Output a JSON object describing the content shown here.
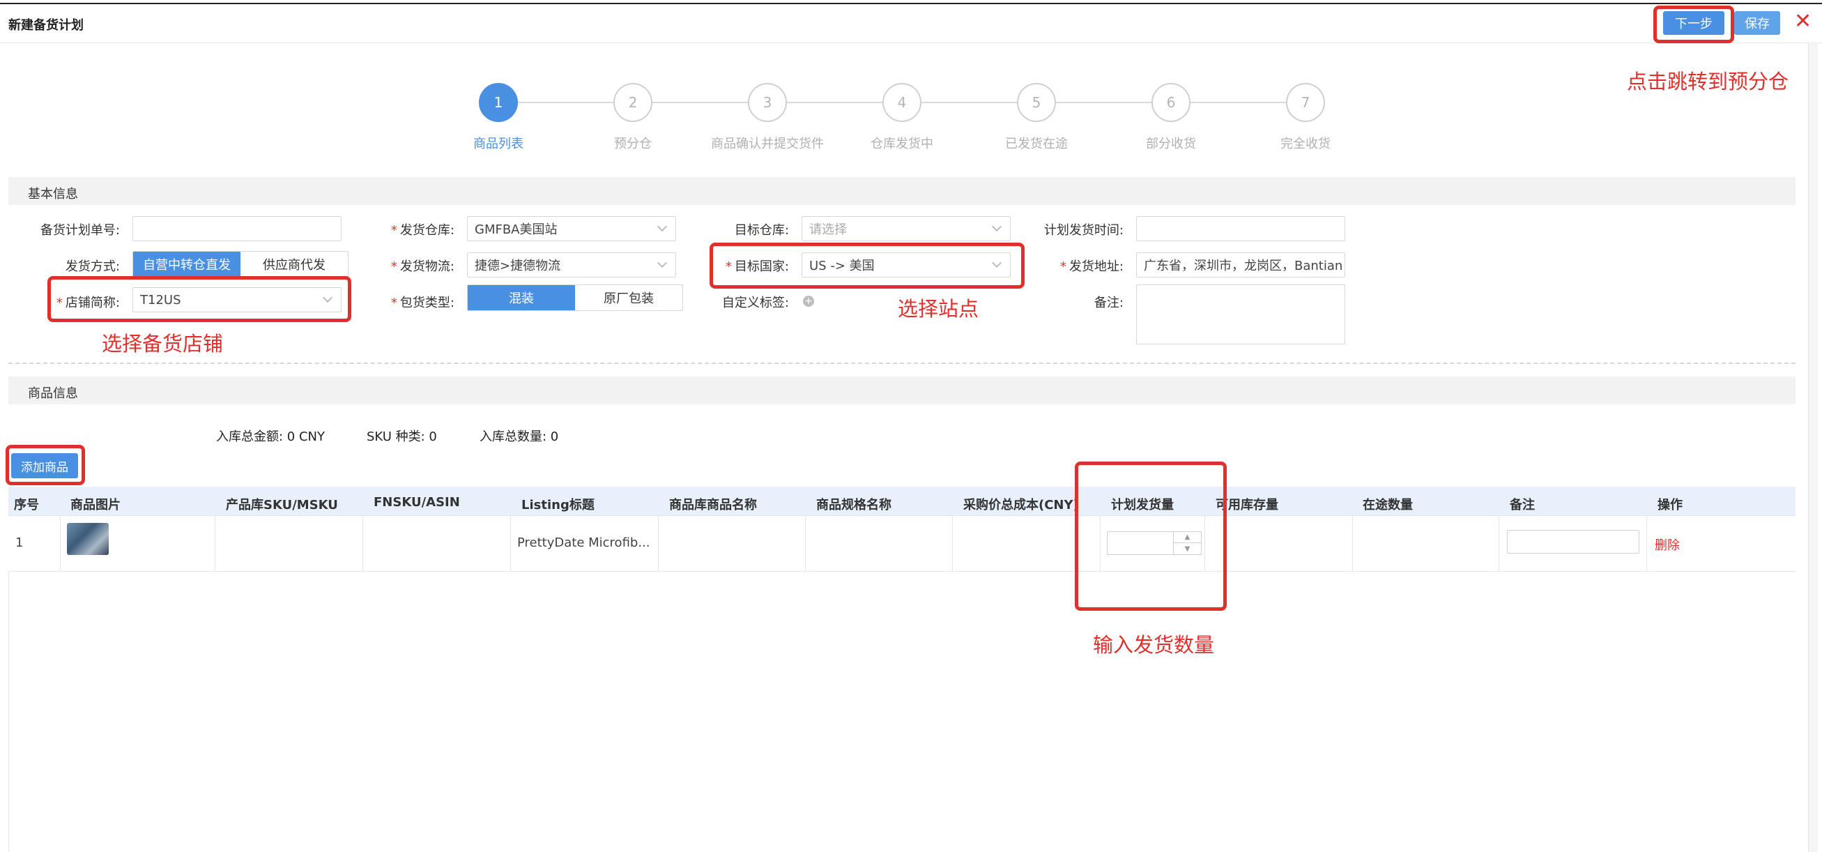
{
  "window": {
    "title": "新建备货计划",
    "next_label": "下一步",
    "save_label": "保存",
    "close_glyph": "✕"
  },
  "annotations": {
    "next_hint": "点击跳转到预分仓",
    "shop_hint": "选择备货店铺",
    "site_hint": "选择站点",
    "qty_hint": "输入发货数量"
  },
  "steps": [
    {
      "num": "1",
      "label": "商品列表",
      "active": true
    },
    {
      "num": "2",
      "label": "预分仓",
      "active": false
    },
    {
      "num": "3",
      "label": "商品确认并提交货件",
      "active": false
    },
    {
      "num": "4",
      "label": "仓库发货中",
      "active": false
    },
    {
      "num": "5",
      "label": "已发货在途",
      "active": false
    },
    {
      "num": "6",
      "label": "部分收货",
      "active": false
    },
    {
      "num": "7",
      "label": "完全收货",
      "active": false
    }
  ],
  "basic": {
    "section_title": "基本信息",
    "plan_no_label": "备货计划单号:",
    "plan_no_value": "",
    "ship_method_label": "发货方式:",
    "ship_method_options": [
      "自营中转仓直发",
      "供应商代发"
    ],
    "shop_label": "店铺简称:",
    "shop_value": "T12US",
    "warehouse_label": "发货仓库:",
    "warehouse_value": "GMFBA美国站",
    "logistics_label": "发货物流:",
    "logistics_value": "捷德>捷德物流",
    "pack_label": "包货类型:",
    "pack_options": [
      "混装",
      "原厂包装"
    ],
    "target_wh_label": "目标仓库:",
    "target_wh_placeholder": "请选择",
    "target_country_label": "目标国家:",
    "target_country_value": "US -> 美国",
    "custom_tag_label": "自定义标签:",
    "plan_time_label": "计划发货时间:",
    "plan_time_value": "",
    "address_label": "发货地址:",
    "address_value": "广东省，深圳市，龙岗区，Bantian",
    "remark_label": "备注:"
  },
  "goods": {
    "section_title": "商品信息",
    "total_amount": "入库总金额: 0 CNY",
    "sku_count": "SKU 种类: 0",
    "total_qty": "入库总数量: 0",
    "add_label": "添加商品",
    "columns": [
      "序号",
      "商品图片",
      "产品库SKU/MSKU",
      "FNSKU/ASIN",
      "Listing标题",
      "商品库商品名称",
      "商品规格名称",
      "采购价总成本(CNY)",
      "计划发货量",
      "可用库存量",
      "在途数量",
      "备注",
      "操作"
    ],
    "rows": [
      {
        "index": "1",
        "listing_title": "PrettyDate Microfib...",
        "delete_label": "删除"
      }
    ]
  }
}
